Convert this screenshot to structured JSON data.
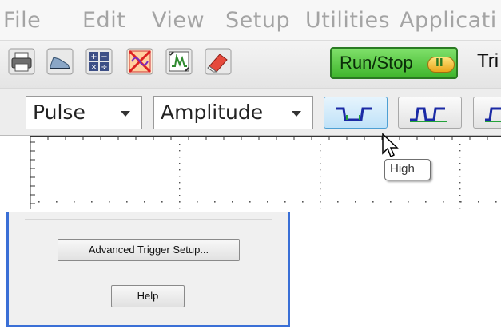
{
  "menu": {
    "items": [
      "File",
      "Edit",
      "View",
      "Setup",
      "Utilities",
      "Applicati"
    ]
  },
  "toolbar": {
    "icons": [
      "printer-icon",
      "shoe-icon",
      "calculator-icon",
      "disable-channels-icon",
      "signal-window-icon",
      "eraser-icon"
    ],
    "run_stop_label": "Run/Stop",
    "run_stop_pill": "II",
    "trigger_label": "Tri",
    "colors": {
      "run_stop_green": "#3fb52c"
    }
  },
  "trigger": {
    "type_value": "Pulse",
    "mode_value": "Amplitude",
    "wave_buttons": [
      "high-pulse-icon",
      "low-pulse-icon",
      "partial-pulse-icon"
    ],
    "tooltip_text": "High"
  },
  "dialog": {
    "advanced_button": "Advanced Trigger Setup...",
    "help_button": "Help",
    "border_color": "#3a6fd6"
  }
}
